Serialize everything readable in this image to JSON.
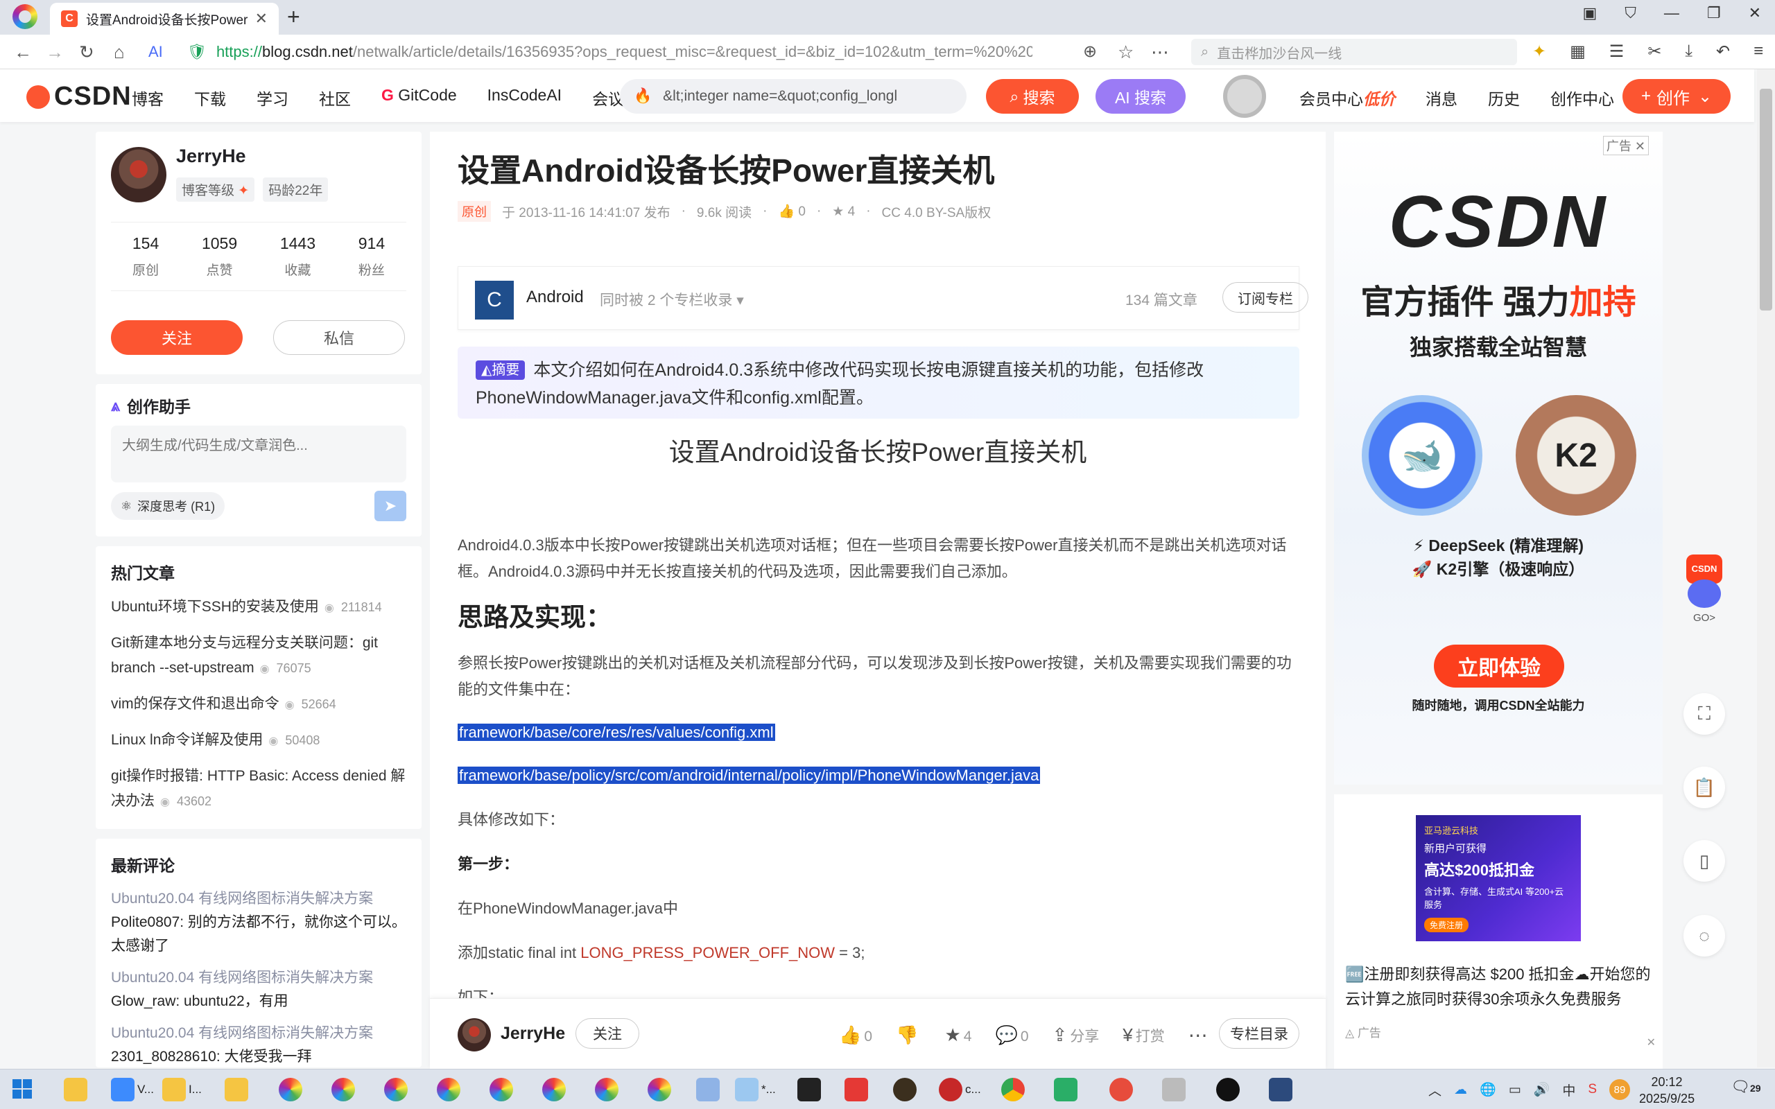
{
  "browser": {
    "tab_title": "设置Android设备长按Power",
    "favicon_letter": "C",
    "url_scheme": "https://",
    "url_host": "blog.csdn.net",
    "url_rest": "/netwalk/article/details/16356935?ops_request_misc=&request_id=&biz_id=102&utm_term=%20%20",
    "search_placeholder": "直击桦加沙台风一线"
  },
  "header": {
    "logo": "CSDN",
    "menu": [
      "博客",
      "下载",
      "学习",
      "社区",
      "GitCode",
      "InsCodeAI",
      "会议"
    ],
    "search_value": "&lt;integer name=&quot;config_longl",
    "search_btn": "搜索",
    "ai_search_btn": "AI 搜索",
    "links": [
      "会员中心",
      "消息",
      "历史",
      "创作中心"
    ],
    "lowprice": "低价",
    "create_btn": "创作"
  },
  "profile": {
    "name": "JerryHe",
    "level_label": "博客等级",
    "age": "码龄22年",
    "stats": [
      {
        "num": "154",
        "label": "原创"
      },
      {
        "num": "1059",
        "label": "点赞"
      },
      {
        "num": "1443",
        "label": "收藏"
      },
      {
        "num": "914",
        "label": "粉丝"
      }
    ],
    "follow": "关注",
    "message": "私信"
  },
  "assistant": {
    "title": "创作助手",
    "placeholder": "大纲生成/代码生成/文章润色...",
    "deep_think": "深度思考 (R1)"
  },
  "hot": {
    "title": "热门文章",
    "items": [
      {
        "title": "Ubuntu环境下SSH的安装及使用",
        "views": "211814"
      },
      {
        "title": "Git新建本地分支与远程分支关联问题：git branch --set-upstream",
        "views": "76075"
      },
      {
        "title": "vim的保存文件和退出命令",
        "views": "52664"
      },
      {
        "title": "Linux ln命令详解及使用",
        "views": "50408"
      },
      {
        "title": "git操作时报错: HTTP Basic: Access denied 解决办法",
        "views": "43602"
      }
    ]
  },
  "comments": {
    "title": "最新评论",
    "items": [
      {
        "article": "Ubuntu20.04 有线网络图标消失解决方案",
        "text": "Polite0807: 别的方法都不行，就你这个可以。太感谢了"
      },
      {
        "article": "Ubuntu20.04 有线网络图标消失解决方案",
        "text": "Glow_raw: ubuntu22，有用"
      },
      {
        "article": "Ubuntu20.04 有线网络图标消失解决方案",
        "text": "2301_80828610: 大佬受我一拜"
      }
    ]
  },
  "article": {
    "title": "设置Android设备长按Power直接关机",
    "original": "原创",
    "date": "于 2013-11-16 14:41:07 发布",
    "reads": "9.6k 阅读",
    "likes": "0",
    "stars": "4",
    "license": "CC 4.0 BY-SA版权",
    "column_name": "Android",
    "column_sub": "同时被 2 个专栏收录",
    "column_count": "134 篇文章",
    "column_btn": "订阅专栏",
    "summary_badge": "摘要",
    "summary": "本文介绍如何在Android4.0.3系统中修改代码实现长按电源键直接关机的功能，包括修改PhoneWindowManager.java文件和config.xml配置。",
    "subheading": "设置Android设备长按Power直接关机",
    "p1": "Android4.0.3版本中长按Power按键跳出关机选项对话框；但在一些项目会需要长按Power直接关机而不是跳出关机选项对话框。Android4.0.3源码中并无长按直接关机的代码及选项，因此需要我们自己添加。",
    "h1": "思路及实现：",
    "p2": "参照长按Power按键跳出的关机对话框及关机流程部分代码，可以发现涉及到长按Power按键，关机及需要实现我们需要的功能的文件集中在：",
    "path1": "framework/base/core/res/res/values/config.xml",
    "path2": "framework/base/policy/src/com/android/internal/policy/impl/PhoneWindowManger.java",
    "p3": "具体修改如下：",
    "step1": "第一步：",
    "p4": "在PhoneWindowManager.java中",
    "code_prefix": "添加static final int ",
    "code_const": "LONG_PRESS_POWER_OFF_NOW",
    "code_suffix": " = 3;",
    "p5": "如下："
  },
  "bottom": {
    "name": "JerryHe",
    "follow": "关注",
    "like": "0",
    "star": "4",
    "comment": "0",
    "share": "分享",
    "reward": "打赏",
    "toc": "专栏目录"
  },
  "ad": {
    "label": "广告",
    "logo": "CSDN",
    "headline_a": "官方插件 强力",
    "headline_b": "加持",
    "sub": "独家搭载全站智慧",
    "circle_k2": "K2",
    "line1": "⚡ DeepSeek (精准理解)",
    "line2": "🚀 K2引擎（极速响应）",
    "cta": "立即体验",
    "foot": "随时随地，调用CSDN全站能力",
    "small_img_t1": "亚马逊云科技",
    "small_img_t2": "新用户可获得",
    "small_img_t3": "高达$200抵扣金",
    "small_img_t4": "含计算、存储、生成式AI 等200+云服务",
    "small_img_t5": "免费注册",
    "small_text": "🆓注册即刻获得高达 $200 抵扣金☁开始您的云计算之旅同时获得30余项永久免费服务",
    "small_label": "广告"
  },
  "float": {
    "csdn": "CSDN",
    "go": "GO>"
  },
  "taskbar": {
    "items": [
      "V...",
      "I..."
    ],
    "c_label": "c...",
    "star_label": "*...",
    "battery": "89",
    "time": "20:12",
    "date": "2025/9/25",
    "notify_count": "29"
  }
}
